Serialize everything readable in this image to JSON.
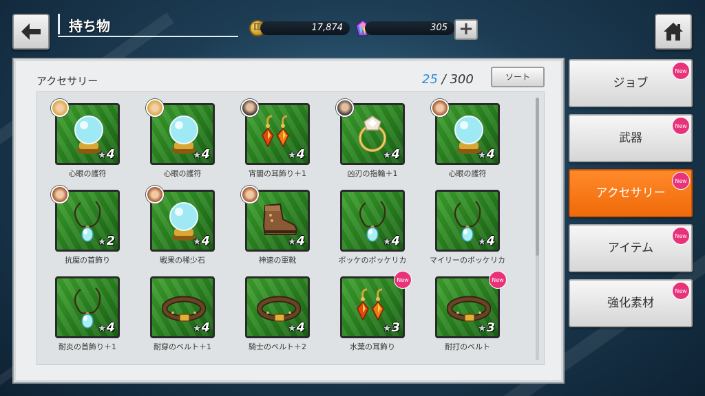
{
  "header": {
    "title": "持ち物",
    "gold": "17,874",
    "gems": "305"
  },
  "panel": {
    "title": "アクセサリー",
    "count_current": "25",
    "count_separator": "/",
    "count_max": "300",
    "sort_label": "ソート"
  },
  "items": [
    {
      "name": "心眼の護符",
      "stars": "4",
      "icon": "crystal-ball-icon",
      "avatar": "blond",
      "new": false
    },
    {
      "name": "心眼の護符",
      "stars": "4",
      "icon": "crystal-ball-icon",
      "avatar": "blond",
      "new": false
    },
    {
      "name": "宵闇の耳飾り＋1",
      "stars": "4",
      "icon": "earring-icon",
      "avatar": "dark",
      "new": false
    },
    {
      "name": "凶刃の指輪＋1",
      "stars": "4",
      "icon": "ring-icon",
      "avatar": "dark",
      "new": false
    },
    {
      "name": "心眼の護符",
      "stars": "4",
      "icon": "crystal-ball-icon",
      "avatar": "brown",
      "new": false
    },
    {
      "name": "抗魔の首飾り",
      "stars": "2",
      "icon": "pendant-icon",
      "avatar": "brown",
      "new": false
    },
    {
      "name": "戦果の稀少石",
      "stars": "4",
      "icon": "crystal-ball-icon",
      "avatar": "brown",
      "new": false
    },
    {
      "name": "神速の軍靴",
      "stars": "4",
      "icon": "boot-icon",
      "avatar": "brown",
      "new": false
    },
    {
      "name": "ボッケのボッケリカ",
      "stars": "4",
      "icon": "pendant-icon",
      "avatar": "",
      "new": false
    },
    {
      "name": "マイリーのボッケリカ",
      "stars": "4",
      "icon": "pendant-icon",
      "avatar": "",
      "new": false
    },
    {
      "name": "耐炎の首飾り＋1",
      "stars": "4",
      "icon": "pendant-icon",
      "avatar": "",
      "new": false
    },
    {
      "name": "耐穿のベルト＋1",
      "stars": "4",
      "icon": "belt-icon",
      "avatar": "",
      "new": false
    },
    {
      "name": "騎士のベルト＋2",
      "stars": "4",
      "icon": "belt-icon",
      "avatar": "",
      "new": false
    },
    {
      "name": "水葉の耳飾り",
      "stars": "3",
      "icon": "earring-icon",
      "avatar": "",
      "new": true
    },
    {
      "name": "耐打のベルト",
      "stars": "3",
      "icon": "belt-icon",
      "avatar": "",
      "new": true
    }
  ],
  "new_label": "New",
  "tabs": [
    {
      "label": "ジョブ",
      "active": false,
      "new": true
    },
    {
      "label": "武器",
      "active": false,
      "new": true
    },
    {
      "label": "アクセサリー",
      "active": true,
      "new": true
    },
    {
      "label": "アイテム",
      "active": false,
      "new": true
    },
    {
      "label": "強化素材",
      "active": false,
      "new": true
    }
  ],
  "colors": {
    "accent": "#f47a1a",
    "tile_green": "#2a8320",
    "new_badge": "#e8327a",
    "count_blue": "#2b8ad9"
  }
}
